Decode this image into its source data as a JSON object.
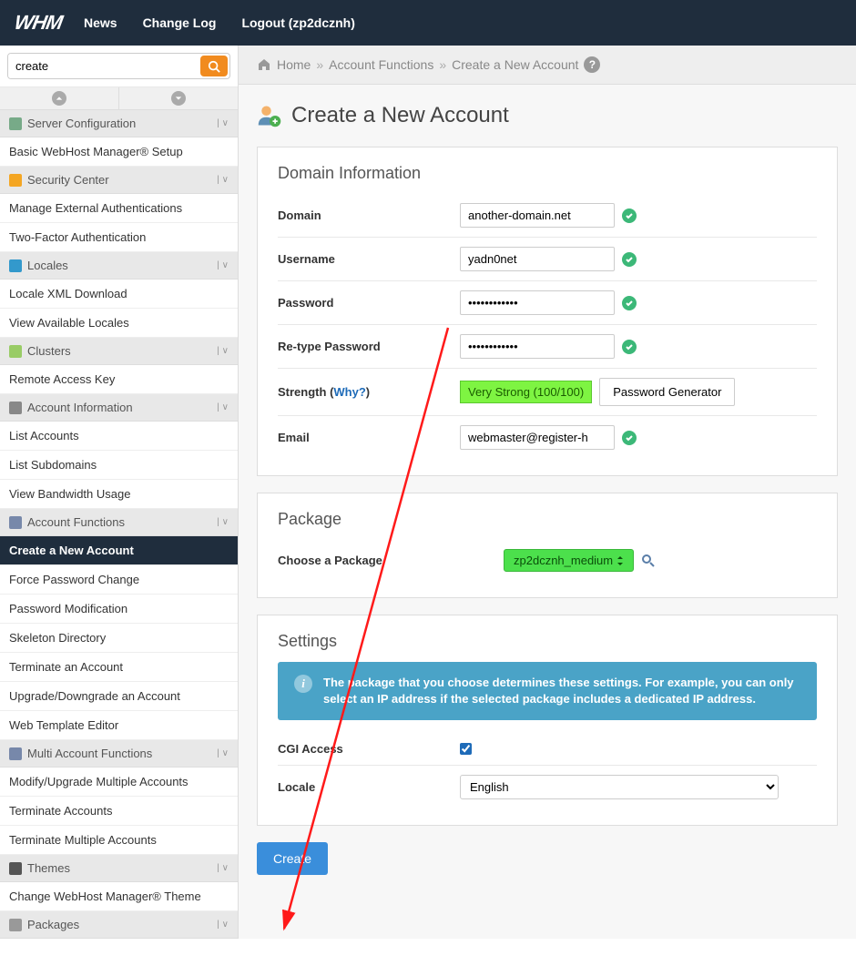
{
  "topnav": {
    "logo": "WHM",
    "links": [
      "News",
      "Change Log",
      "Logout (zp2dcznh)"
    ]
  },
  "search": {
    "value": "create"
  },
  "nav": [
    {
      "type": "header",
      "label": "Server Configuration",
      "icon": "server"
    },
    {
      "type": "item",
      "label": "Basic WebHost Manager® Setup"
    },
    {
      "type": "header",
      "label": "Security Center",
      "icon": "lock"
    },
    {
      "type": "item",
      "label": "Manage External Authentications"
    },
    {
      "type": "item",
      "label": "Two-Factor Authentication"
    },
    {
      "type": "header",
      "label": "Locales",
      "icon": "globe"
    },
    {
      "type": "item",
      "label": "Locale XML Download"
    },
    {
      "type": "item",
      "label": "View Available Locales"
    },
    {
      "type": "header",
      "label": "Clusters",
      "icon": "cluster"
    },
    {
      "type": "item",
      "label": "Remote Access Key"
    },
    {
      "type": "header",
      "label": "Account Information",
      "icon": "info"
    },
    {
      "type": "item",
      "label": "List Accounts"
    },
    {
      "type": "item",
      "label": "List Subdomains"
    },
    {
      "type": "item",
      "label": "View Bandwidth Usage"
    },
    {
      "type": "header",
      "label": "Account Functions",
      "icon": "user"
    },
    {
      "type": "item",
      "label": "Create a New Account",
      "active": true
    },
    {
      "type": "item",
      "label": "Force Password Change"
    },
    {
      "type": "item",
      "label": "Password Modification"
    },
    {
      "type": "item",
      "label": "Skeleton Directory"
    },
    {
      "type": "item",
      "label": "Terminate an Account"
    },
    {
      "type": "item",
      "label": "Upgrade/Downgrade an Account"
    },
    {
      "type": "item",
      "label": "Web Template Editor"
    },
    {
      "type": "header",
      "label": "Multi Account Functions",
      "icon": "users"
    },
    {
      "type": "item",
      "label": "Modify/Upgrade Multiple Accounts"
    },
    {
      "type": "item",
      "label": "Terminate Accounts"
    },
    {
      "type": "item",
      "label": "Terminate Multiple Accounts"
    },
    {
      "type": "header",
      "label": "Themes",
      "icon": "theme"
    },
    {
      "type": "item",
      "label": "Change WebHost Manager® Theme"
    },
    {
      "type": "header",
      "label": "Packages",
      "icon": "package"
    }
  ],
  "breadcrumb": {
    "home": "Home",
    "sect": "Account Functions",
    "page": "Create a New Account"
  },
  "page_title": "Create a New Account",
  "domain_info": {
    "title": "Domain Information",
    "domain_label": "Domain",
    "domain_value": "another-domain.net",
    "username_label": "Username",
    "username_value": "yadn0net",
    "password_label": "Password",
    "password_value": "••••••••••••",
    "repassword_label": "Re-type Password",
    "repassword_value": "••••••••••••",
    "strength_label": "Strength",
    "strength_why": "Why?",
    "strength_badge": "Very Strong (100/100)",
    "pwdgen_label": "Password Generator",
    "email_label": "Email",
    "email_value": "webmaster@register-h"
  },
  "package": {
    "title": "Package",
    "choose_label": "Choose a Package",
    "selected": "zp2dcznh_medium"
  },
  "settings": {
    "title": "Settings",
    "notice": "The package that you choose determines these settings. For example, you can only select an IP address if the selected package includes a dedicated IP address.",
    "cgi_label": "CGI Access",
    "cgi_checked": true,
    "locale_label": "Locale",
    "locale_value": "English"
  },
  "create_button": "Create"
}
